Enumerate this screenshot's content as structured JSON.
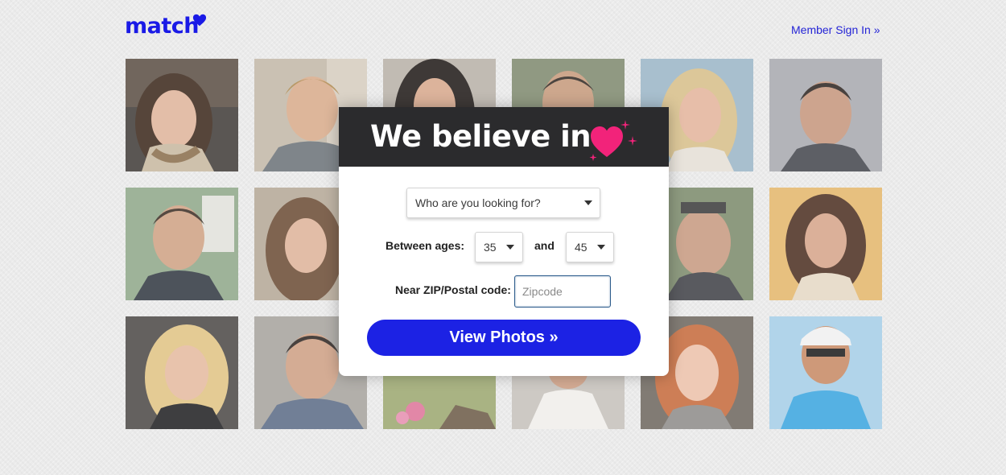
{
  "header": {
    "logo_text": "match",
    "sign_in_label": "Member Sign In »"
  },
  "modal": {
    "headline": "We believe in",
    "seeking": {
      "selected": "Who are you looking for?"
    },
    "ages": {
      "label": "Between ages:",
      "min": "35",
      "and_label": "and",
      "max": "45"
    },
    "zip": {
      "label": "Near ZIP/Postal code:",
      "placeholder": "Zipcode",
      "value": ""
    },
    "cta_label": "View Photos »"
  },
  "colors": {
    "brand_blue": "#1c22e4",
    "heart_pink": "#f2237a",
    "header_dark": "#2b2b2d"
  }
}
